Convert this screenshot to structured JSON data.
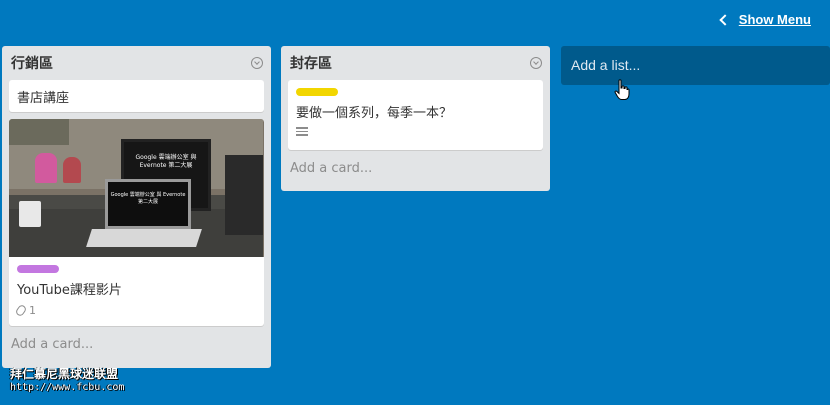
{
  "header": {
    "show_menu_label": "Show Menu"
  },
  "lists": [
    {
      "title": "行銷區",
      "cards": [
        {
          "text": "書店講座"
        },
        {
          "text": "YouTube課程影片",
          "label_color": "#c377e0",
          "attachments_count": "1",
          "cover_image_text": "Google 雲端辦公室 與 Evernote 第二大展"
        }
      ],
      "add_card_label": "Add a card..."
    },
    {
      "title": "封存區",
      "cards": [
        {
          "text": "要做一個系列，每季一本？",
          "label_color": "#f2d600",
          "has_description": true
        }
      ],
      "add_card_label": "Add a card..."
    }
  ],
  "add_list": {
    "label": "Add a list..."
  },
  "watermark": {
    "line1": "拜仁慕尼黑球迷联盟",
    "line2": "http://www.fcbu.com"
  },
  "colors": {
    "board_background": "#0079bf",
    "list_background": "#e2e4e6",
    "add_list_background": "#005a8c"
  },
  "icons": {
    "show_menu": "chevron-left-icon",
    "list_menu": "chevron-down-circle-icon",
    "attachment": "paperclip-icon",
    "description": "description-lines-icon",
    "cursor": "hand-pointer-icon"
  }
}
